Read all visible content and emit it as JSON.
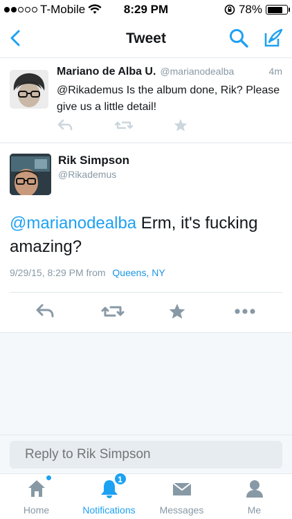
{
  "status_bar": {
    "carrier": "T-Mobile",
    "time": "8:29 PM",
    "battery_percent": "78%",
    "battery_level": 0.78,
    "signal_bars_filled": 2,
    "signal_bars_total": 5
  },
  "navbar": {
    "title": "Tweet",
    "back_icon": "chevron-left-icon",
    "search_icon": "search-icon",
    "compose_icon": "compose-tweet-icon"
  },
  "parent_tweet": {
    "name": "Mariano de Alba U.",
    "handle": "@marianodealba",
    "time_ago": "4m",
    "text": "@Rikademus Is the album done, Rik? Please give us a little detail!"
  },
  "main_tweet": {
    "name": "Rik Simpson",
    "handle": "@Rikademus",
    "mention": "@marianodealba",
    "text": " Erm, it's fucking amazing?",
    "timestamp": "9/29/15, 8:29 PM from",
    "location": "Queens, NY"
  },
  "reply": {
    "placeholder": "Reply to Rik Simpson"
  },
  "tabbar": {
    "tabs": [
      {
        "label": "Home",
        "icon": "home-icon"
      },
      {
        "label": "Notifications",
        "icon": "bell-icon",
        "badge": "1"
      },
      {
        "label": "Messages",
        "icon": "envelope-icon"
      },
      {
        "label": "Me",
        "icon": "person-icon"
      }
    ]
  },
  "colors": {
    "accent": "#1da1f2",
    "text": "#14171a",
    "secondary": "#8899a6",
    "divider": "#e1e8ed"
  }
}
